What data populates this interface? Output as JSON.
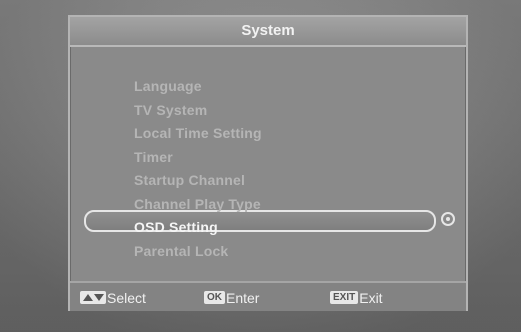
{
  "window": {
    "title": "System"
  },
  "menu": {
    "items": [
      {
        "label": "Language",
        "selected": false
      },
      {
        "label": "TV System",
        "selected": false
      },
      {
        "label": "Local Time Setting",
        "selected": false
      },
      {
        "label": "Timer",
        "selected": false
      },
      {
        "label": "Startup Channel",
        "selected": false
      },
      {
        "label": "Channel Play Type",
        "selected": false
      },
      {
        "label": "OSD Setting",
        "selected": true
      },
      {
        "label": "Parental Lock",
        "selected": false
      }
    ]
  },
  "footer": {
    "select": {
      "key_icon": "up-down-arrow-icon",
      "label": "Select"
    },
    "enter": {
      "key": "OK",
      "label": "Enter"
    },
    "exit": {
      "key": "EXIT",
      "label": "Exit"
    }
  },
  "colors": {
    "panel": "#8a8a8a",
    "text_dim": "#b5b5b5",
    "text_active": "#f5f5f5",
    "highlight_border": "#e6e6e6"
  }
}
